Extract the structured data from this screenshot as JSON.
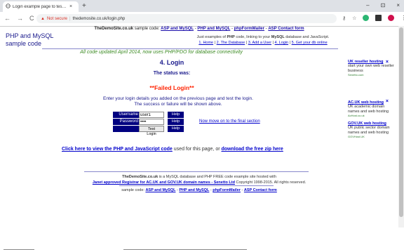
{
  "browser": {
    "tab_title": "Login example page to test the l",
    "tab_close": "×",
    "new_tab": "+",
    "window_controls": [
      "–",
      "⊡",
      "×"
    ],
    "nav": [
      "←",
      "→",
      "C"
    ],
    "security_label": "Not secure",
    "url": "thedemosite.co.uk/login.php",
    "toolbar_icons": [
      "key-icon",
      "star-icon",
      "extension-green-icon",
      "extension-dark-icon",
      "extension-red-icon",
      "menu-icon"
    ],
    "menu_glyph": "⋮"
  },
  "page": {
    "top_strip": {
      "brand": "TheDemoSite.co.uk",
      "sample_code_label": "sample code:",
      "links": [
        "ASP and MySQL",
        "PHP and MySQL",
        "phpFormMailer",
        "ASP Contact form"
      ]
    },
    "logo_line1": "PHP and MySQL",
    "logo_line2": "sample code",
    "header": {
      "text_start": "Just examples of",
      "php": "PHP",
      "text_mid": "code, linking to your",
      "mysql": "MySQL",
      "text_end": "database and JavaScript.",
      "nav": [
        "1. Home",
        "2. The Database",
        "3. Add a User",
        "4. Login",
        "5. Get your db online"
      ]
    },
    "updated_note": "All code updated April 2014, now uses PHP/PDO for database connectivity",
    "title": "4. Login",
    "status_label": "The status was:",
    "status_value": "**Failed Login**",
    "instructions_line1": "Enter your login details you added on the previous page and test the login.",
    "instructions_line2": "The success or failure will be shown above.",
    "login": {
      "username_label": "Username",
      "username_value": "user1",
      "password_label": "Password",
      "password_value": "••••",
      "button_label": "Test Login",
      "help_label": "Help"
    },
    "move_on_link": "Now move on to the final section",
    "view_code": {
      "link1": "Click here to view the PHP and JavaScript code",
      "mid": "used for this page, or",
      "link2": "download the free zip here"
    },
    "footer": {
      "brand": "TheDemoSite.co.uk",
      "text": "is a MySQL database and PHP FREE code example site hosted with",
      "link": "Janet approved Registrar for AC.UK and GOV.UK domain names - Senetto Ltd",
      "copyright": "Copyright 1998-2015.  All rights reserved."
    },
    "footer2": {
      "label": "sample code:",
      "links": [
        "ASP and MySQL",
        "PHP and MySQL",
        "phpFormMailer",
        "ASP Contact form"
      ]
    },
    "ads": [
      {
        "heading": "UK reseller hosting",
        "text": "start your own web reseller business",
        "url": "Senetto.com"
      },
      {
        "heading": "AC.UK web hosting",
        "text": "UK academic domain names and web hosting",
        "url": "AcHost.co.uk"
      },
      {
        "heading": "GOV.UK web hosting",
        "text": "UK public sector domain names and web hosting",
        "url": "GOVHost.UK"
      }
    ],
    "ad_close": "×"
  }
}
